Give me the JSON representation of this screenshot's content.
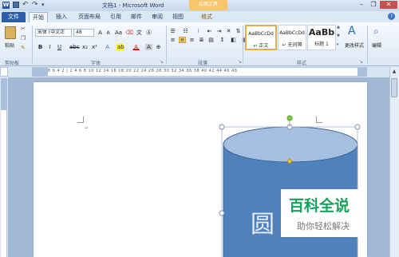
{
  "window": {
    "title": "文档1 - Microsoft Word",
    "context_tab_group": "绘图工具"
  },
  "tabs": [
    {
      "label": "文件"
    },
    {
      "label": "开始"
    },
    {
      "label": "插入"
    },
    {
      "label": "页面布局"
    },
    {
      "label": "引用"
    },
    {
      "label": "邮件"
    },
    {
      "label": "审阅"
    },
    {
      "label": "视图"
    },
    {
      "label": "格式"
    }
  ],
  "ribbon": {
    "clipboard": {
      "paste_label": "粘贴",
      "group_label": "剪贴板"
    },
    "font": {
      "font_name": "宋体 (中文正",
      "font_size": "48",
      "group_label": "字体"
    },
    "paragraph": {
      "group_label": "段落"
    },
    "styles": {
      "items": [
        {
          "sample": "AaBbCcDd",
          "name": "↵ 正文"
        },
        {
          "sample": "AaBbCcDd",
          "name": "↵ 无间隔"
        },
        {
          "sample": "AaBb",
          "name": "标题 1"
        }
      ],
      "change_styles_label": "更改样式",
      "group_label": "样式"
    },
    "editing": {
      "label": "编辑"
    }
  },
  "ruler": {
    "numbers": "8 6 4 2 | 2 4 6 8 10 12 14 16 18 20 22 24 26 28 30 32 34 36 38 40 42 44 46 48"
  },
  "document": {
    "shape_text": "圆"
  },
  "watermark": {
    "title": "百科全说",
    "subtitle": "助你轻松解决"
  },
  "colors": {
    "cylinder_body": "#4f81bd",
    "cylinder_top": "#a7bfde",
    "file_tab": "#2a5ea8",
    "context_group": "#f7c56c",
    "watermark_green": "#17a05a"
  }
}
